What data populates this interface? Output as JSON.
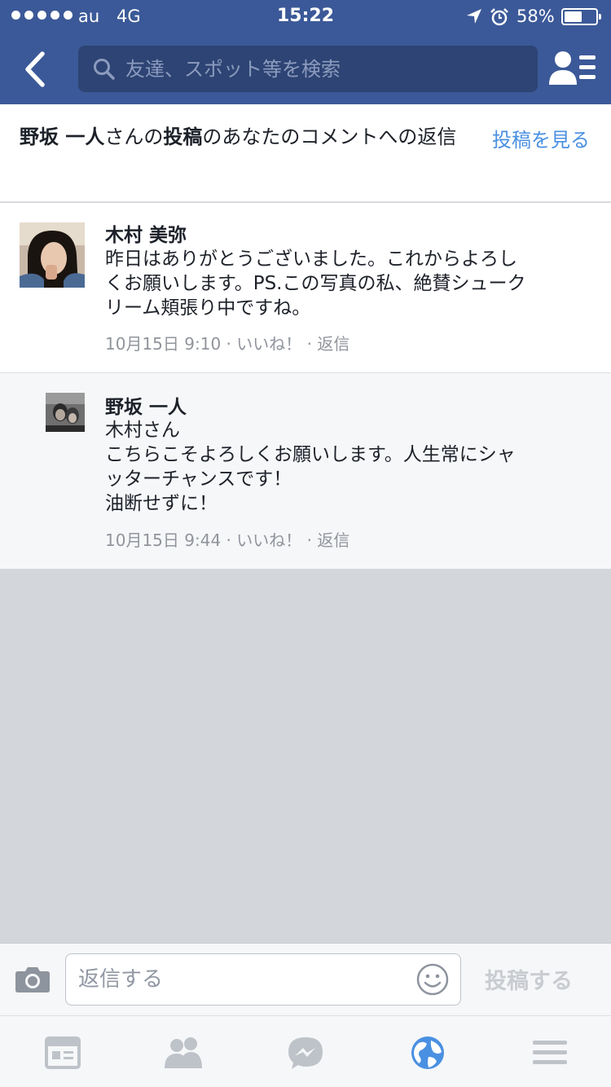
{
  "status_bar": {
    "carrier": "au",
    "network": "4G",
    "time": "15:22",
    "battery": "58%",
    "battery_level": 0.58
  },
  "header": {
    "search_placeholder": "友達、スポット等を検索",
    "brand_color": "#3b5998"
  },
  "notification": {
    "author": "野坂 一人",
    "text_1": "さんの",
    "post_word": "投稿",
    "text_2": "のあなたのコメントへの返信",
    "view_post": "投稿を見る"
  },
  "comments": [
    {
      "author": "木村 美弥",
      "lines": [
        "昨日はありがとうございました。これからよろし",
        "くお願いします。PS.この写真の私、絶賛シューク",
        "リーム頬張り中ですね。"
      ],
      "date": "10月15日 9:10",
      "like": "いいね！",
      "reply": "返信"
    },
    {
      "author": "野坂 一人",
      "lines": [
        "木村さん",
        "こちらこそよろしくお願いします。人生常にシャ",
        "ッターチャンスです！",
        "油断せずに！"
      ],
      "date": "10月15日 9:44",
      "like": "いいね！",
      "reply": "返信"
    }
  ],
  "composer": {
    "placeholder": "返信する",
    "post_label": "投稿する"
  },
  "tabbar": {
    "icons": [
      "news-feed-icon",
      "friends-icon",
      "messenger-icon",
      "notifications-globe-icon",
      "menu-icon"
    ],
    "active": "notifications-globe-icon",
    "active_color": "#4a90e2",
    "inactive_color": "#bec3c9"
  }
}
